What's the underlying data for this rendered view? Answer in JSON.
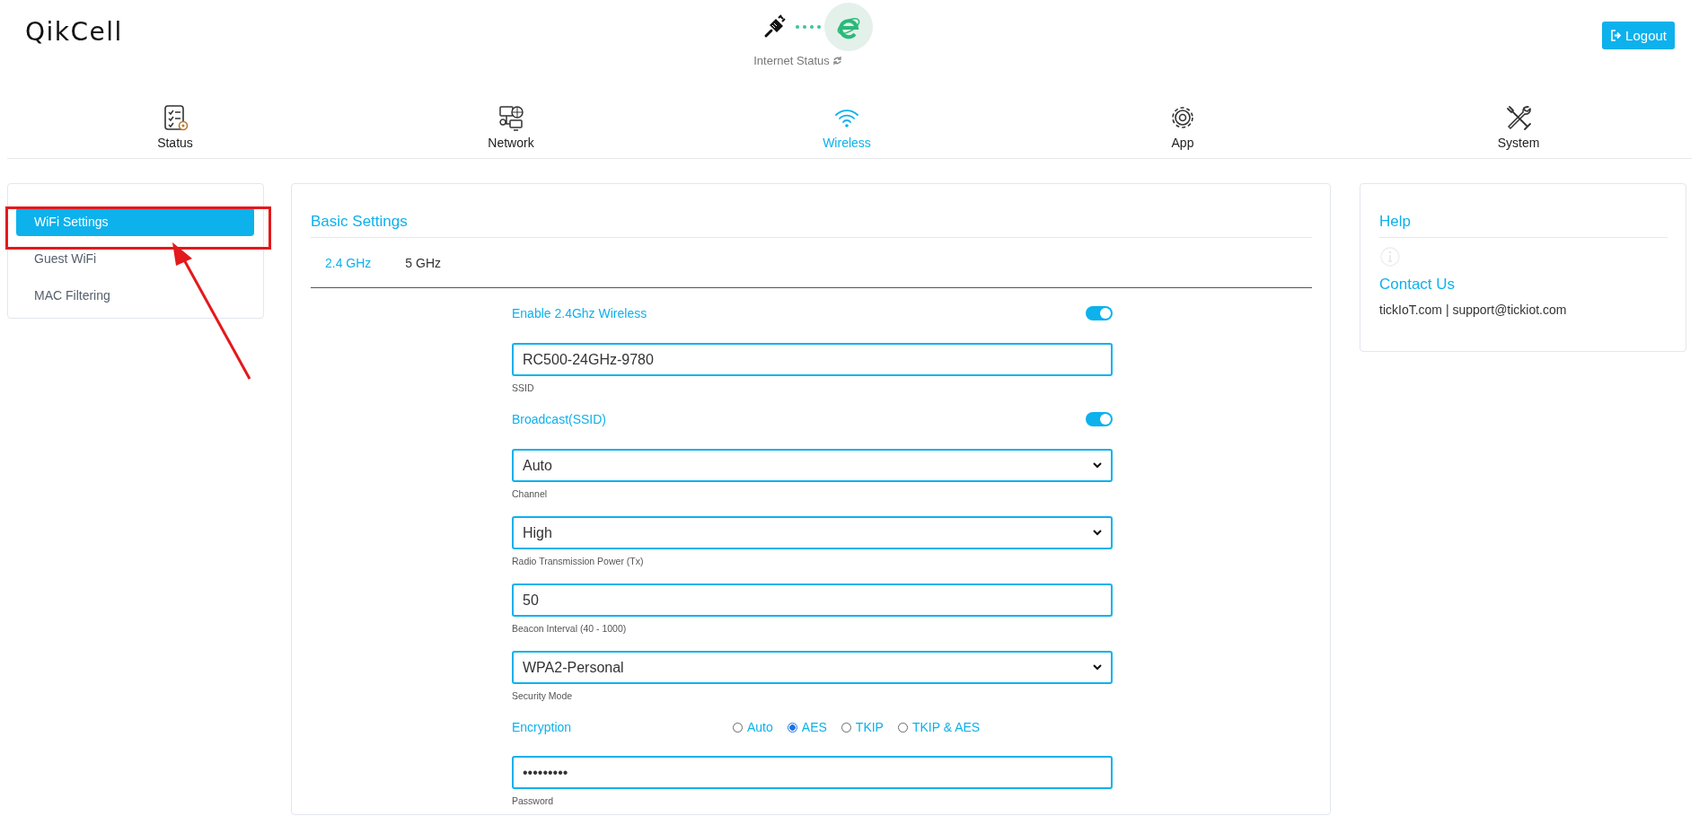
{
  "header": {
    "logo": "QikCell",
    "internet_status": "Internet Status",
    "logout": "Logout"
  },
  "nav": [
    {
      "label": "Status",
      "kind": "checklist",
      "selected": false
    },
    {
      "label": "Network",
      "kind": "network",
      "selected": false
    },
    {
      "label": "Wireless",
      "kind": "wifi",
      "selected": true
    },
    {
      "label": "App",
      "kind": "gear",
      "selected": false
    },
    {
      "label": "System",
      "kind": "tools",
      "selected": false
    }
  ],
  "sidebar": {
    "items": [
      {
        "label": "WiFi Settings",
        "selected": true
      },
      {
        "label": "Guest WiFi",
        "selected": false
      },
      {
        "label": "MAC Filtering",
        "selected": false
      }
    ]
  },
  "settings": {
    "title": "Basic Settings",
    "tabs": [
      {
        "label": "2.4 GHz",
        "selected": true
      },
      {
        "label": "5 GHz",
        "selected": false
      }
    ],
    "fields": [
      {
        "kind": "toggle",
        "label": "Enable 2.4Ghz Wireless",
        "on": true
      },
      {
        "kind": "text",
        "value": "RC500-24GHz-9780",
        "caption": "SSID"
      },
      {
        "kind": "toggle",
        "label": "Broadcast(SSID)",
        "on": true
      },
      {
        "kind": "select",
        "value": "Auto",
        "caption": "Channel"
      },
      {
        "kind": "select",
        "value": "High",
        "caption": "Radio Transmission Power (Tx)"
      },
      {
        "kind": "text",
        "value": "50",
        "caption": "Beacon Interval (40 - 1000)"
      },
      {
        "kind": "select",
        "value": "WPA2-Personal",
        "caption": "Security Mode"
      },
      {
        "kind": "radio",
        "label": "Encryption",
        "options": [
          {
            "label": "Auto",
            "selected": false
          },
          {
            "label": "AES",
            "selected": true
          },
          {
            "label": "TKIP",
            "selected": false
          },
          {
            "label": "TKIP & AES",
            "selected": false
          }
        ]
      },
      {
        "kind": "text",
        "value": "•••••••••",
        "caption": "Password"
      }
    ]
  },
  "help": {
    "title": "Help",
    "contact_title": "Contact Us",
    "contact": "tickIoT.com | support@tickiot.com"
  }
}
